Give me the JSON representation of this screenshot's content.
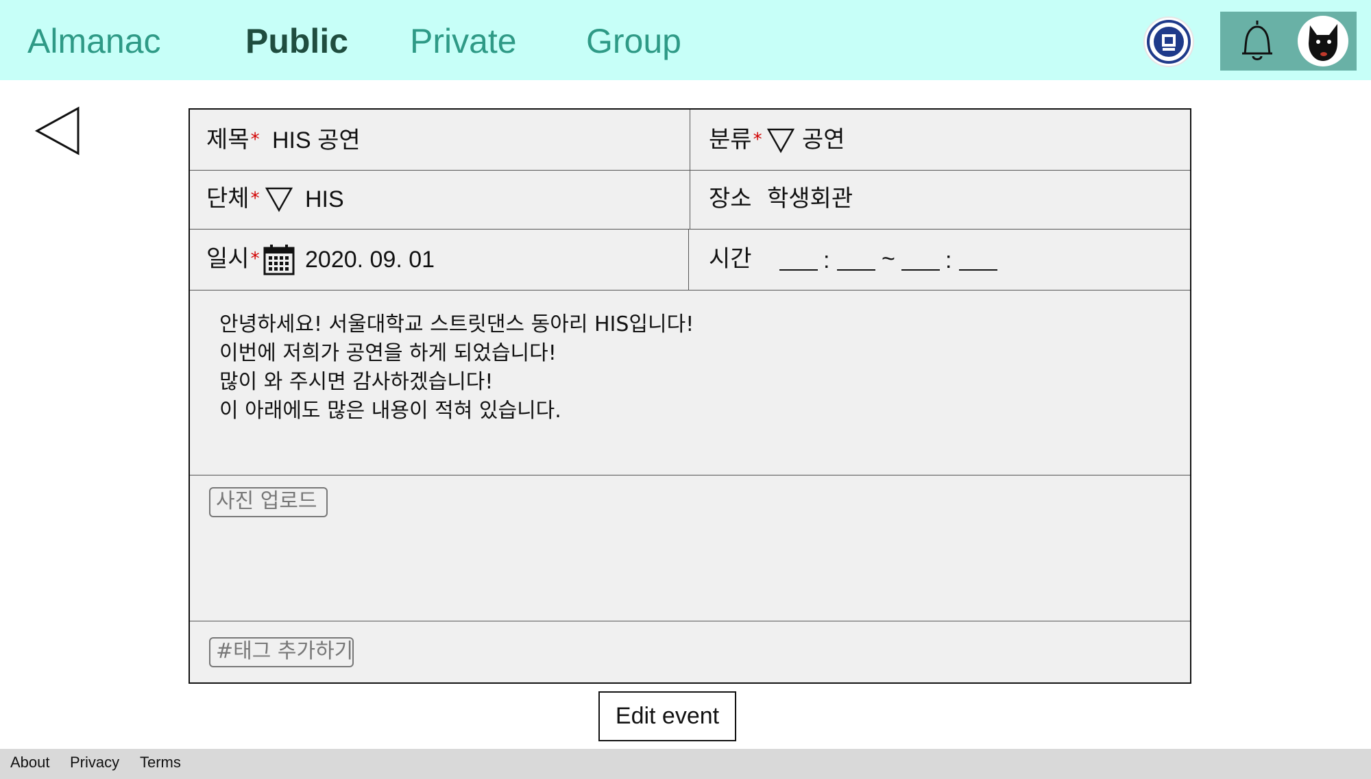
{
  "header": {
    "brand": "Almanac",
    "tabs": [
      {
        "label": "Public",
        "active": true
      },
      {
        "label": "Private",
        "active": false
      },
      {
        "label": "Group",
        "active": false
      }
    ],
    "icons": [
      "university-logo-icon",
      "bell-icon",
      "user-avatar-icon"
    ],
    "colors": {
      "background": "#c7fff8",
      "tab_text": "#2e9a86",
      "user_box": "#69b1a6"
    }
  },
  "form": {
    "title_label": "제목",
    "title_value": "HIS 공연",
    "category_label": "분류",
    "category_value": "공연",
    "group_label": "단체",
    "group_value": "HIS",
    "place_label": "장소",
    "place_value": "학생회관",
    "date_label": "일시",
    "date_value": "2020. 09. 01",
    "time_label": "시간",
    "time_separator": ":",
    "time_range_separator": "~",
    "required_mark": "*",
    "description": [
      "안녕하세요! 서울대학교 스트릿댄스 동아리 HIS입니다!",
      "이번에 저희가 공연을 하게 되었습니다!",
      "많이 와 주시면 감사하겠습니다!",
      "이 아래에도 많은 내용이 적혀 있습니다."
    ],
    "photo_upload_label": "사진 업로드",
    "tag_add_label": "#태그 추가하기"
  },
  "actions": {
    "edit_label": "Edit event"
  },
  "footer": {
    "links": [
      "About",
      "Privacy",
      "Terms"
    ]
  }
}
